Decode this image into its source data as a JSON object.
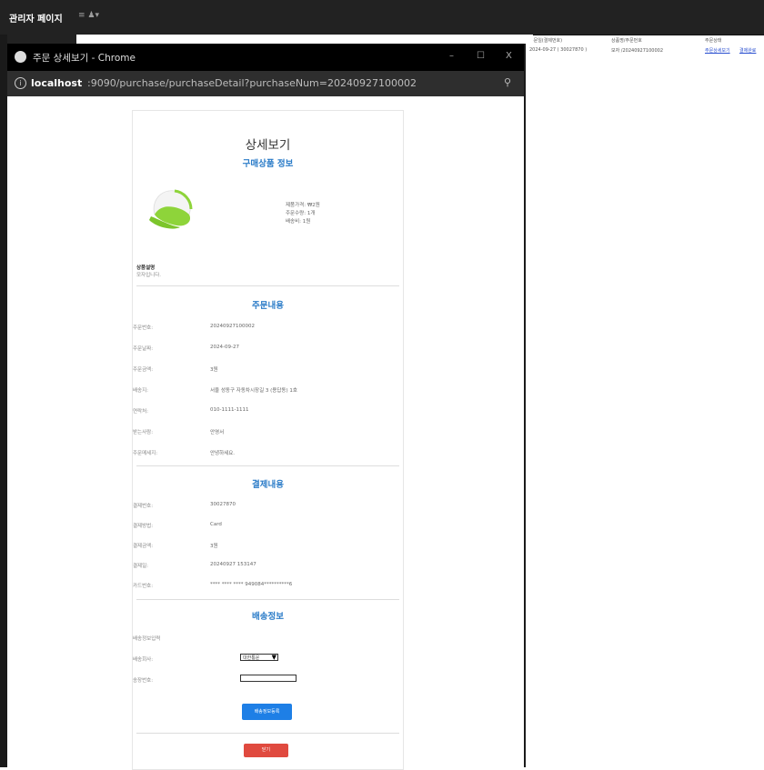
{
  "admin": {
    "title": "관리자 페이지",
    "menu_icon": "≡",
    "user_icon": "♟▾"
  },
  "background_table": {
    "headers": [
      "주문일(결제번호)",
      "상품명/주문번호",
      "주문상태"
    ],
    "row": [
      "2024-09-27 ( 30027870 )",
      "모자 /20240927100002",
      "주문상세보기"
    ],
    "link2": "결제완료"
  },
  "popup": {
    "window_title": "주문 상세보기 - Chrome",
    "min_btn": "–",
    "max_btn": "☐",
    "close_btn": "X",
    "url_host": "localhost",
    "url_path": ":9090/purchase/purchaseDetail?purchaseNum=20240927100002",
    "info_icon": "i",
    "zoom_icon": "⚲"
  },
  "detail": {
    "title": "상세보기",
    "product_section": "구매상품 정보",
    "product_lines": [
      "제품가격: ₩2원",
      "주문수량: 1개",
      "배송비: 1원"
    ],
    "desc_label": "상품설명",
    "desc_value": "모자입니다.",
    "order_section": "주문내용",
    "order_rows": [
      {
        "label": "주문번호:",
        "value": "20240927100002"
      },
      {
        "label": "주문날짜:",
        "value": "2024-09-27"
      },
      {
        "label": "주문금액:",
        "value": "3원"
      },
      {
        "label": "배송지:",
        "value": "서울 성동구 자동차시장길 3 (용답동) 1호"
      },
      {
        "label": "연락처:",
        "value": "010-1111-1111"
      },
      {
        "label": "받는사람:",
        "value": "안영서"
      },
      {
        "label": "주문메세지:",
        "value": "안녕하세요."
      }
    ],
    "payment_section": "결제내용",
    "payment_rows": [
      {
        "label": "결제번호:",
        "value": "30027870"
      },
      {
        "label": "결제방법:",
        "value": "Card"
      },
      {
        "label": "결제금액:",
        "value": "3원"
      },
      {
        "label": "결제일:",
        "value": "20240927 153147"
      },
      {
        "label": "카드번호:",
        "value": "**** **** **** 949084**********6"
      }
    ],
    "delivery_section": "배송정보",
    "delivery_input_label": "배송정보입력",
    "courier_label": "배송회사:",
    "courier_selected": "대한통운",
    "tracking_label": "송장번호:",
    "tracking_value": "",
    "submit_button": "배송정보등록",
    "close_button": "닫기"
  },
  "colors": {
    "accent": "#2b7cc8",
    "primary_button": "#1e7fe6",
    "danger_button": "#e04a3f",
    "admin_bar": "#222222"
  }
}
